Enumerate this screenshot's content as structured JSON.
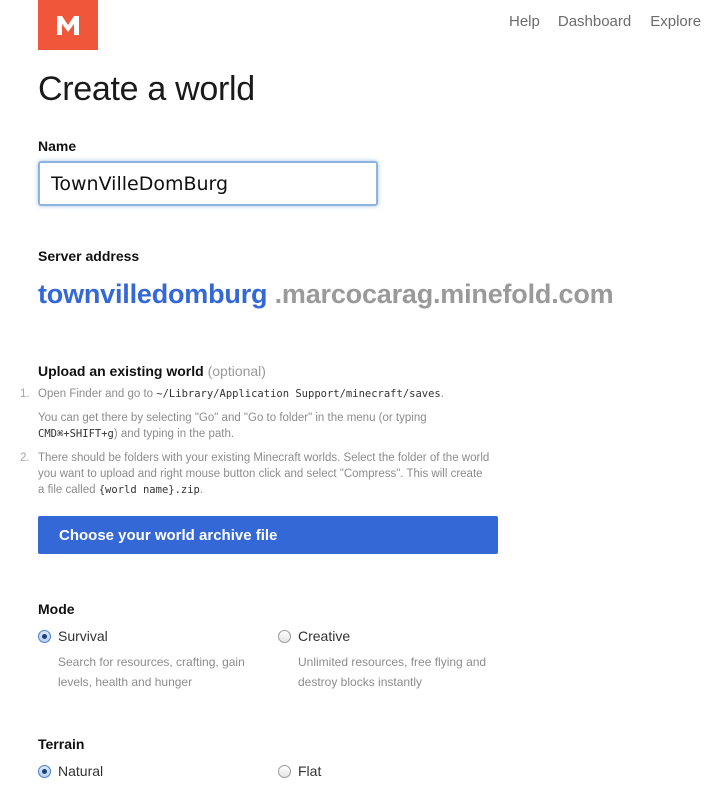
{
  "header": {
    "logo_letter": "M",
    "brand_color": "#f0563a",
    "nav": [
      "Help",
      "Dashboard",
      "Explore W"
    ]
  },
  "page": {
    "title": "Create a world"
  },
  "name_field": {
    "label": "Name",
    "value": "TownVilleDomBurg"
  },
  "server_address": {
    "label": "Server address",
    "subdomain": "townvilledomburg",
    "domain": ".marcocarag.minefold.com"
  },
  "upload": {
    "label": "Upload an existing world",
    "optional": "(optional)",
    "steps": [
      {
        "num": "1.",
        "line1_pre": "Open Finder and go to ",
        "line1_code": "~/Library/Application Support/minecraft/saves",
        "line1_post": ".",
        "line2_pre": "You can get there by selecting \"Go\" and \"Go to folder\" in the menu (or typing ",
        "line2_code": "CMD⌘+SHIFT+g",
        "line2_post": ") and typing in the path."
      },
      {
        "num": "2.",
        "text_pre": "There should be folders with your existing Minecraft worlds. Select the folder of the world you want to upload and right mouse button click and select \"Compress\". This will create a file called ",
        "text_code": "{world name}.zip",
        "text_post": "."
      }
    ],
    "button_label": "Choose your world archive file"
  },
  "mode": {
    "label": "Mode",
    "options": [
      {
        "label": "Survival",
        "description": "Search for resources, crafting, gain levels, health and hunger",
        "checked": true
      },
      {
        "label": "Creative",
        "description": "Unlimited resources, free flying and destroy blocks instantly",
        "checked": false
      }
    ]
  },
  "terrain": {
    "label": "Terrain",
    "options": [
      {
        "label": "Natural",
        "checked": true
      },
      {
        "label": "Flat",
        "checked": false
      }
    ]
  },
  "colors": {
    "accent": "#3468d6",
    "muted": "#9a9a9a"
  }
}
